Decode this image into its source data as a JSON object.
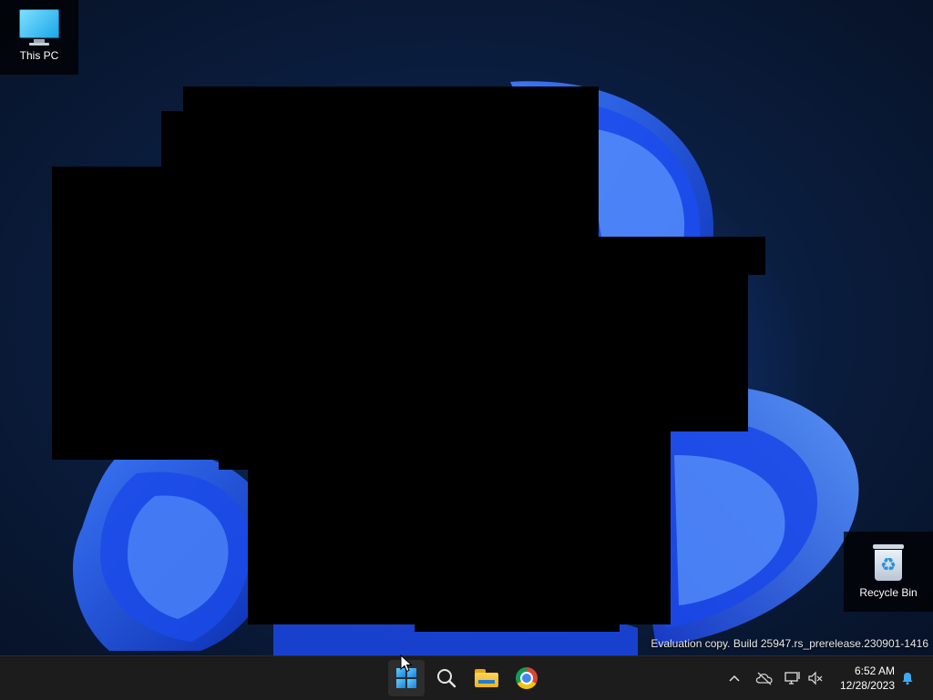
{
  "desktop": {
    "icons": [
      {
        "label": "This PC",
        "icon": "monitor-icon"
      },
      {
        "label": "Recycle Bin",
        "icon": "recycle-bin-icon"
      }
    ],
    "watermark": "Evaluation copy. Build 25947.rs_prerelease.230901-1416"
  },
  "taskbar": {
    "apps": [
      {
        "name": "Start",
        "icon": "windows-logo-icon"
      },
      {
        "name": "Search",
        "icon": "search-icon"
      },
      {
        "name": "File Explorer",
        "icon": "folder-icon"
      },
      {
        "name": "Google Chrome",
        "icon": "chrome-icon"
      }
    ],
    "tray": {
      "time": "6:52 AM",
      "date": "12/28/2023",
      "icons": [
        "chevron-up-icon",
        "onedrive-offline-icon",
        "network-icon",
        "volume-muted-icon",
        "notification-bell-icon"
      ]
    }
  },
  "colors": {
    "taskbar_bg": "#1c1c1c",
    "wallpaper_accent": "#1f5fff",
    "notification_accent": "#3fa9f5"
  }
}
